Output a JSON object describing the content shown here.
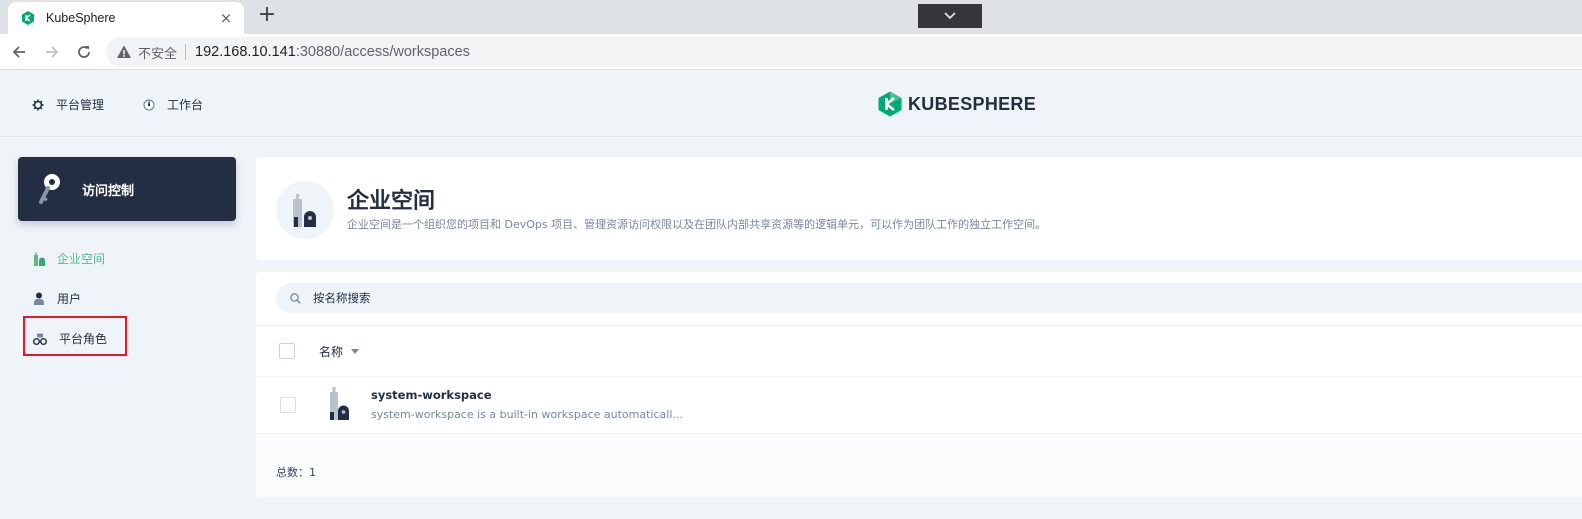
{
  "browser": {
    "tab_title": "KubeSphere",
    "tab_close": "×",
    "new_tab": "+",
    "insecure_label": "不安全",
    "url_host": "192.168.10.141",
    "url_path": ":30880/access/workspaces"
  },
  "header": {
    "nav": [
      {
        "label": "平台管理",
        "icon": "gear-icon"
      },
      {
        "label": "工作台",
        "icon": "dashboard-icon"
      }
    ],
    "logo_text": "KUBESPHERE"
  },
  "sidebar": {
    "card_title": "访问控制",
    "items": [
      {
        "label": "企业空间",
        "icon": "workspace-icon",
        "active": true
      },
      {
        "label": "用户",
        "icon": "user-icon",
        "active": false
      },
      {
        "label": "平台角色",
        "icon": "roles-icon",
        "active": false
      }
    ]
  },
  "banner": {
    "title": "企业空间",
    "description": "企业空间是一个组织您的项目和 DevOps 项目、管理资源访问权限以及在团队内部共享资源等的逻辑单元，可以作为团队工作的独立工作空间。"
  },
  "list": {
    "search_placeholder": "按名称搜索",
    "column_name": "名称",
    "rows": [
      {
        "name": "system-workspace",
        "description": "system-workspace is a built-in workspace automaticall..."
      }
    ],
    "total_label": "总数：1"
  },
  "colors": {
    "accent_green": "#55bc8a",
    "dark": "#242e42",
    "highlight_red": "#e8182a"
  }
}
